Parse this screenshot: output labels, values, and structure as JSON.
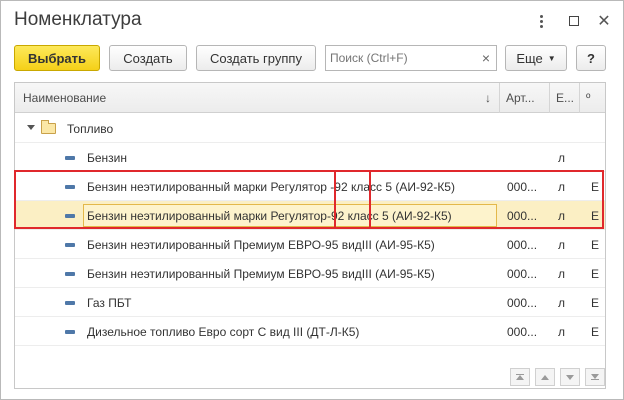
{
  "window": {
    "title": "Номенклатура"
  },
  "toolbar": {
    "select_label": "Выбрать",
    "create_label": "Создать",
    "create_group_label": "Создать группу",
    "search_placeholder": "Поиск (Ctrl+F)",
    "search_clear": "×",
    "more_label": "Еще",
    "help_label": "?"
  },
  "grid": {
    "columns": [
      "Наименование",
      "Арт...",
      "Е...",
      "º"
    ],
    "sort_indicator": "↓",
    "group": {
      "label": "Топливо"
    },
    "rows": [
      {
        "name": "Бензин",
        "article": "",
        "unit": "л",
        "extra": ""
      },
      {
        "name": "Бензин неэтилированный марки Регулятор -92 класс 5 (АИ-92-К5)",
        "article": "000...",
        "unit": "л",
        "extra": "Е"
      },
      {
        "name": "Бензин неэтилированный марки Регулятор-92 класс 5 (АИ-92-К5)",
        "article": "000...",
        "unit": "л",
        "extra": "Е"
      },
      {
        "name": "Бензин неэтилированный Премиум ЕВРО-95 видIII (АИ-95-К5)",
        "article": "000...",
        "unit": "л",
        "extra": "Е"
      },
      {
        "name": "Бензин неэтилированный Премиум ЕВРО-95 видIII (АИ-95-К5)",
        "article": "000...",
        "unit": "л",
        "extra": "Е"
      },
      {
        "name": "Газ ПБТ",
        "article": "000...",
        "unit": "л",
        "extra": "Е"
      },
      {
        "name": "Дизельное топливо Евро сорт С вид III (ДТ-Л-К5)",
        "article": "000...",
        "unit": "л",
        "extra": "Е"
      }
    ]
  },
  "colors": {
    "primary_button": "#f5d018",
    "selection": "#fbefc4",
    "highlight_box": "#e0282c",
    "item_icon": "#4f78a8"
  }
}
